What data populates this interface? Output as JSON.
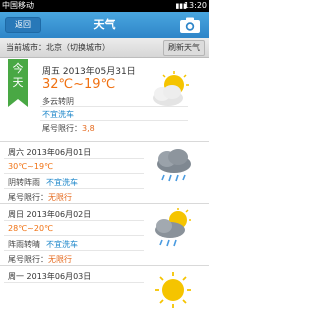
{
  "status_bar": {
    "carrier": "中国移动",
    "time": "13:20"
  },
  "nav": {
    "back_label": "返回",
    "title": "天气"
  },
  "city": {
    "current_city_text": "当前城市：北京（切换城市）",
    "refresh_label": "刷新天气"
  },
  "today": {
    "badge": "今天",
    "date": "周五 2013年05月31日",
    "temp": "32℃~19℃",
    "condition": "多云转阴",
    "car_wash": "不宜洗车",
    "plate_label": "尾号限行：",
    "plate_value": "3,8",
    "icon": "partly-cloudy-icon"
  },
  "forecast": [
    {
      "date": "周六 2013年06月01日",
      "temp": "30℃~19℃",
      "condition": "阴转阵雨",
      "car_wash": "不宜洗车",
      "plate_label": "尾号限行：",
      "plate_value": "无限行",
      "icon": "cloud-rain-icon"
    },
    {
      "date": "周日 2013年06月02日",
      "temp": "28℃~20℃",
      "condition": "阵雨转晴",
      "car_wash": "不宜洗车",
      "plate_label": "尾号限行：",
      "plate_value": "无限行",
      "icon": "sun-cloud-rain-icon"
    },
    {
      "date": "周一 2013年06月03日",
      "temp": "",
      "condition": "",
      "car_wash": "",
      "plate_label": "",
      "plate_value": "",
      "icon": "sunny-icon"
    }
  ],
  "colors": {
    "nav_blue": "#3a95d4",
    "today_green": "#49a844",
    "temp_orange": "#f07010",
    "car_blue": "#1a85c9"
  }
}
